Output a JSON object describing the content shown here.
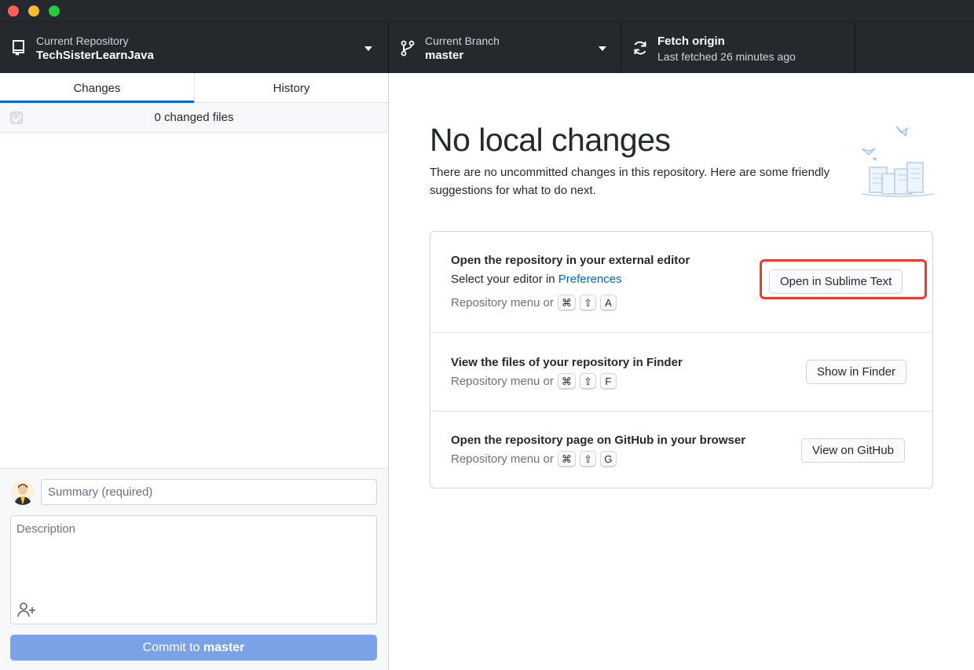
{
  "toolbar": {
    "repository": {
      "label": "Current Repository",
      "name": "TechSisterLearnJava"
    },
    "branch": {
      "label": "Current Branch",
      "name": "master"
    },
    "fetch": {
      "title": "Fetch origin",
      "status": "Last fetched 26 minutes ago"
    }
  },
  "sidebar": {
    "tabs": [
      {
        "label": "Changes",
        "active": true
      },
      {
        "label": "History",
        "active": false
      }
    ],
    "changed_files": "0 changed files",
    "commit": {
      "summary_placeholder": "Summary (required)",
      "description_placeholder": "Description",
      "button_prefix": "Commit to ",
      "button_branch": "master"
    }
  },
  "main": {
    "title": "No local changes",
    "subtitle": "There are no uncommitted changes in this repository. Here are some friendly suggestions for what to do next.",
    "suggestions": [
      {
        "title": "Open the repository in your external editor",
        "line_prefix": "Select your editor in ",
        "line_link": "Preferences",
        "shortcut_prefix": "Repository menu or",
        "keys": [
          "⌘",
          "⇧",
          "A"
        ],
        "button": "Open in Sublime Text"
      },
      {
        "title": "View the files of your repository in Finder",
        "shortcut_prefix": "Repository menu or",
        "keys": [
          "⌘",
          "⇧",
          "F"
        ],
        "button": "Show in Finder"
      },
      {
        "title": "Open the repository page on GitHub in your browser",
        "shortcut_prefix": "Repository menu or",
        "keys": [
          "⌘",
          "⇧",
          "G"
        ],
        "button": "View on GitHub"
      }
    ]
  },
  "colors": {
    "toolbar_bg": "#24292e",
    "accent": "#0366d6",
    "commit_button": "#79a3e6",
    "highlight": "#e53d2f"
  }
}
